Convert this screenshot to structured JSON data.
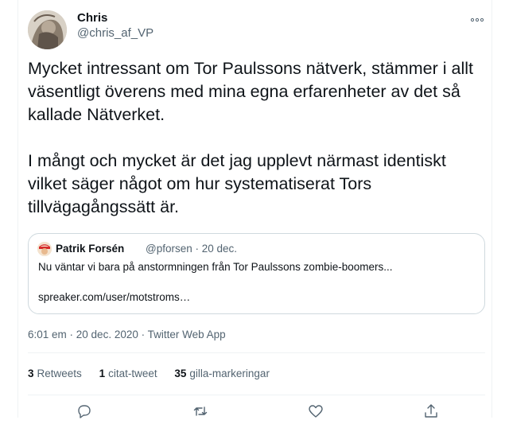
{
  "tweet": {
    "author_name": "Chris",
    "author_handle": "@chris_af_VP",
    "paragraphs": [
      "Mycket intressant om Tor Paulssons nätverk, stämmer i allt väsentligt överens med mina egna erfarenheter av det så kallade Nätverket.",
      "I mångt och mycket är det jag upplevt närmast identiskt vilket säger något om hur systematiserat Tors tillvägagångssätt är."
    ],
    "more_icon": "more-dots-icon"
  },
  "quote": {
    "author_name": "Patrik Forsén",
    "meta": "@pforsen · 20 dec.",
    "text": "Nu väntar vi bara på anstormningen från Tor Paulssons zombie-boomers...",
    "link": "spreaker.com/user/motstroms…"
  },
  "timestamp": {
    "time": "6:01 em",
    "date": "20 dec. 2020",
    "source": "Twitter Web App",
    "separator": " · "
  },
  "stats": {
    "retweets_count": "3",
    "retweets_label": "Retweets",
    "quotes_count": "1",
    "quotes_label": "citat-tweet",
    "likes_count": "35",
    "likes_label": "gilla-markeringar"
  },
  "actions": [
    "reply-icon",
    "retweet-icon",
    "like-icon",
    "share-icon"
  ],
  "colors": {
    "text": "#0f1419",
    "secondary": "#536471",
    "border": "#cfd9de",
    "divider": "#eff3f4"
  }
}
